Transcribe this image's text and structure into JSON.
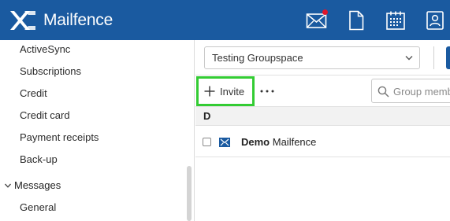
{
  "brand": {
    "name": "Mailfence"
  },
  "topbar": {
    "icons": [
      "mail-icon",
      "document-icon",
      "calendar-icon",
      "contacts-icon"
    ],
    "has_unread": true
  },
  "sidebar": {
    "items": [
      "ActiveSync",
      "Subscriptions",
      "Credit",
      "Credit card",
      "Payment receipts",
      "Back-up"
    ],
    "section": {
      "label": "Messages",
      "expanded": true
    },
    "sub_items": [
      "General"
    ]
  },
  "main": {
    "group_select": {
      "value": "Testing Groupspace"
    },
    "toolbar": {
      "invite_label": "Invite",
      "more_label": "···"
    },
    "search": {
      "placeholder": "Group members"
    },
    "group_letter": "D",
    "members": [
      {
        "first": "Demo",
        "last": "Mailfence"
      }
    ]
  },
  "colors": {
    "brand": "#1a5aa0",
    "highlight": "#33cc33",
    "notification": "#e0162b"
  }
}
